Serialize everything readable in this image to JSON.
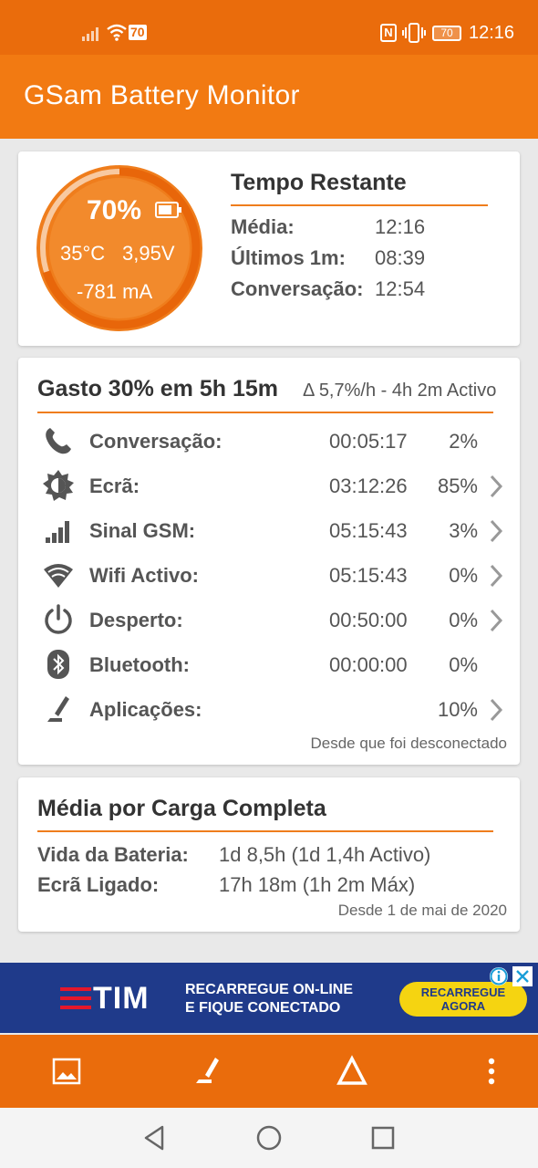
{
  "status_bar": {
    "wifi_badge": "70",
    "battery_text": "70",
    "time": "12:16",
    "icons": [
      "signal-icon",
      "wifi-icon",
      "nfc-icon",
      "vibrate-icon",
      "battery-icon"
    ]
  },
  "app_bar": {
    "title": "GSam Battery Monitor"
  },
  "gauge": {
    "percent_label": "70%",
    "percent_value": 70,
    "temperature": "35°C",
    "voltage": "3,95V",
    "current": "-781 mA"
  },
  "tempo": {
    "title": "Tempo Restante",
    "rows": [
      {
        "label": "Média:",
        "value": "12:16"
      },
      {
        "label": "Últimos 1m:",
        "value": "08:39"
      },
      {
        "label": "Conversação:",
        "value": "12:54"
      }
    ]
  },
  "usage": {
    "title": "Gasto 30% em 5h 15m",
    "subtitle": "Δ 5,7%/h - 4h 2m Activo",
    "rows": [
      {
        "icon": "phone-icon",
        "label": "Conversação:",
        "time": "00:05:17",
        "pct": "2%",
        "chevron": false
      },
      {
        "icon": "brightness-icon",
        "label": "Ecrã:",
        "time": "03:12:26",
        "pct": "85%",
        "chevron": true
      },
      {
        "icon": "cell-signal-icon",
        "label": "Sinal GSM:",
        "time": "05:15:43",
        "pct": "3%",
        "chevron": true
      },
      {
        "icon": "wifi-icon",
        "label": "Wifi Activo:",
        "time": "05:15:43",
        "pct": "0%",
        "chevron": true
      },
      {
        "icon": "power-icon",
        "label": "Desperto:",
        "time": "00:50:00",
        "pct": "0%",
        "chevron": true
      },
      {
        "icon": "bluetooth-icon",
        "label": "Bluetooth:",
        "time": "00:00:00",
        "pct": "0%",
        "chevron": false
      },
      {
        "icon": "apps-icon",
        "label": "Aplicações:",
        "time": "",
        "pct": "10%",
        "chevron": true
      }
    ],
    "note": "Desde que foi desconectado"
  },
  "average": {
    "title": "Média por Carga Completa",
    "rows": [
      {
        "label": "Vida da Bateria:",
        "value": "1d 8,5h (1d 1,4h Activo)"
      },
      {
        "label": "Ecrã Ligado:",
        "value": "17h 18m (1h 2m Máx)"
      }
    ],
    "note": "Desde 1 de mai de 2020"
  },
  "ad": {
    "brand": "TIM",
    "line1": "RECARREGUE ON-LINE",
    "line2": "E FIQUE CONECTADO",
    "cta_line1": "RECARREGUE",
    "cta_line2": "AGORA"
  },
  "bottom_bar": {
    "icons": [
      "image-icon",
      "apps-icon",
      "delta-icon",
      "more-vert-icon"
    ]
  },
  "nav_bar": {
    "icons": [
      "back-icon",
      "home-icon",
      "recents-icon"
    ]
  },
  "colors": {
    "primary": "#f27a12",
    "primary_dark": "#ea6c0c",
    "gauge_fill": "#f28a2c",
    "accent_line": "#ef7d1c",
    "ad_bg": "#1f3a8a",
    "ad_button": "#f5d411"
  }
}
